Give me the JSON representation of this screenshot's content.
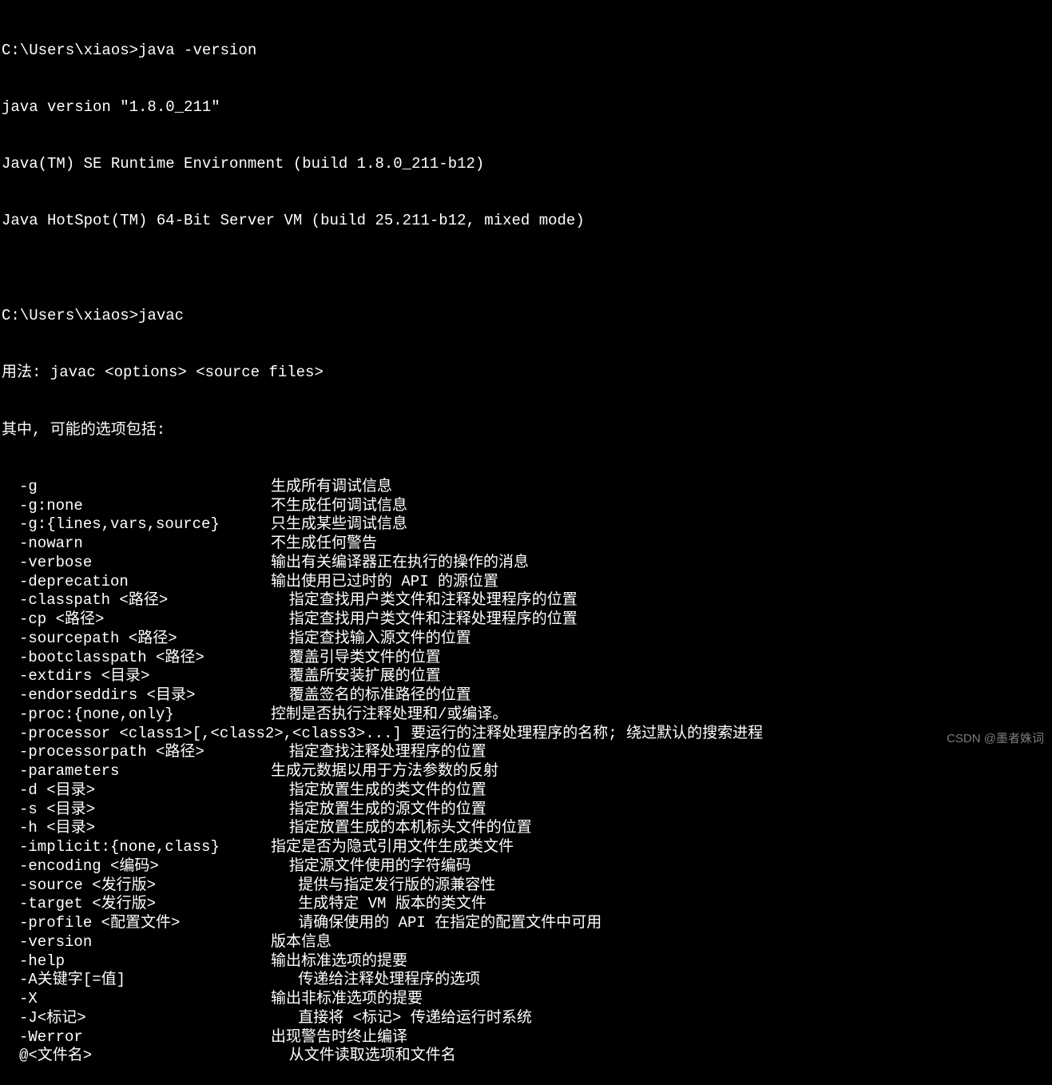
{
  "prompt1": "C:\\Users\\xiaos>java -version",
  "out1": "java version \"1.8.0_211\"",
  "out2": "Java(TM) SE Runtime Environment (build 1.8.0_211-b12)",
  "out3": "Java HotSpot(TM) 64-Bit Server VM (build 25.211-b12, mixed mode)",
  "blank": "",
  "prompt2": "C:\\Users\\xiaos>javac",
  "usage": "用法: javac <options> <source files>",
  "where": "其中, 可能的选项包括:",
  "options": [
    {
      "flag": "-g",
      "desc": "生成所有调试信息"
    },
    {
      "flag": "-g:none",
      "desc": "不生成任何调试信息"
    },
    {
      "flag": "-g:{lines,vars,source}",
      "desc": "只生成某些调试信息"
    },
    {
      "flag": "-nowarn",
      "desc": "不生成任何警告"
    },
    {
      "flag": "-verbose",
      "desc": "输出有关编译器正在执行的操作的消息"
    },
    {
      "flag": "-deprecation",
      "desc": "输出使用已过时的 API 的源位置"
    },
    {
      "flag": "-classpath <路径>",
      "desc": "  指定查找用户类文件和注释处理程序的位置"
    },
    {
      "flag": "-cp <路径>",
      "desc": "  指定查找用户类文件和注释处理程序的位置"
    },
    {
      "flag": "-sourcepath <路径>",
      "desc": "  指定查找输入源文件的位置"
    },
    {
      "flag": "-bootclasspath <路径>",
      "desc": "  覆盖引导类文件的位置"
    },
    {
      "flag": "-extdirs <目录>",
      "desc": "  覆盖所安装扩展的位置"
    },
    {
      "flag": "-endorseddirs <目录>",
      "desc": "  覆盖签名的标准路径的位置"
    },
    {
      "flag": "-proc:{none,only}",
      "desc": "控制是否执行注释处理和/或编译。"
    },
    {
      "flag": "-processor <class1>[,<class2>,<class3>...] 要运行的注释处理程序的名称; 绕过默认的搜索进程",
      "desc": ""
    },
    {
      "flag": "-processorpath <路径>",
      "desc": "  指定查找注释处理程序的位置"
    },
    {
      "flag": "-parameters",
      "desc": "生成元数据以用于方法参数的反射"
    },
    {
      "flag": "-d <目录>",
      "desc": "  指定放置生成的类文件的位置"
    },
    {
      "flag": "-s <目录>",
      "desc": "  指定放置生成的源文件的位置"
    },
    {
      "flag": "-h <目录>",
      "desc": "  指定放置生成的本机标头文件的位置"
    },
    {
      "flag": "-implicit:{none,class}",
      "desc": "指定是否为隐式引用文件生成类文件"
    },
    {
      "flag": "-encoding <编码>",
      "desc": "  指定源文件使用的字符编码"
    },
    {
      "flag": "-source <发行版>",
      "desc": "   提供与指定发行版的源兼容性"
    },
    {
      "flag": "-target <发行版>",
      "desc": "   生成特定 VM 版本的类文件"
    },
    {
      "flag": "-profile <配置文件>",
      "desc": "   请确保使用的 API 在指定的配置文件中可用"
    },
    {
      "flag": "-version",
      "desc": "版本信息"
    },
    {
      "flag": "-help",
      "desc": "输出标准选项的提要"
    },
    {
      "flag": "-A关键字[=值]",
      "desc": "   传递给注释处理程序的选项"
    },
    {
      "flag": "-X",
      "desc": "输出非标准选项的提要"
    },
    {
      "flag": "-J<标记>",
      "desc": "   直接将 <标记> 传递给运行时系统"
    },
    {
      "flag": "-Werror",
      "desc": "出现警告时终止编译"
    },
    {
      "flag": "@<文件名>",
      "desc": "  从文件读取选项和文件名"
    }
  ],
  "watermark": "CSDN @墨者姝词"
}
